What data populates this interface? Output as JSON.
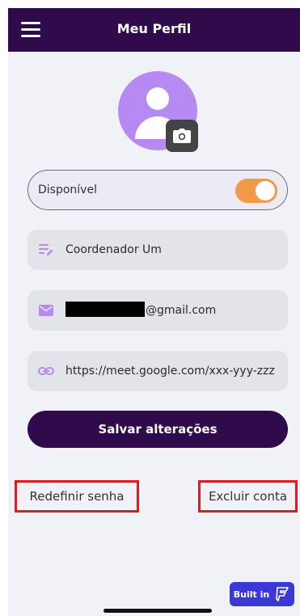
{
  "header": {
    "title": "Meu Perfil",
    "menu_icon": "hamburger-menu-icon"
  },
  "avatar": {
    "icon": "user-avatar-icon",
    "camera_icon": "camera-icon"
  },
  "status": {
    "label": "Disponível",
    "toggle_on": true
  },
  "fields": {
    "name": {
      "icon": "edit-lines-icon",
      "value": "Coordenador Um"
    },
    "email": {
      "icon": "mail-icon",
      "value": "@gmail.com",
      "redacted_prefix": true
    },
    "link": {
      "icon": "link-icon",
      "value": "https://meet.google.com/xxx-yyy-zzz"
    }
  },
  "actions": {
    "save_label": "Salvar alterações",
    "reset_password_label": "Redefinir senha",
    "delete_account_label": "Excluir conta"
  },
  "badge": {
    "label": "Built in"
  },
  "colors": {
    "primary": "#2f0b4c",
    "accent": "#b58bf3",
    "toggle": "#f29a4a",
    "highlight": "#e01a22",
    "badge": "#3c38d6"
  }
}
